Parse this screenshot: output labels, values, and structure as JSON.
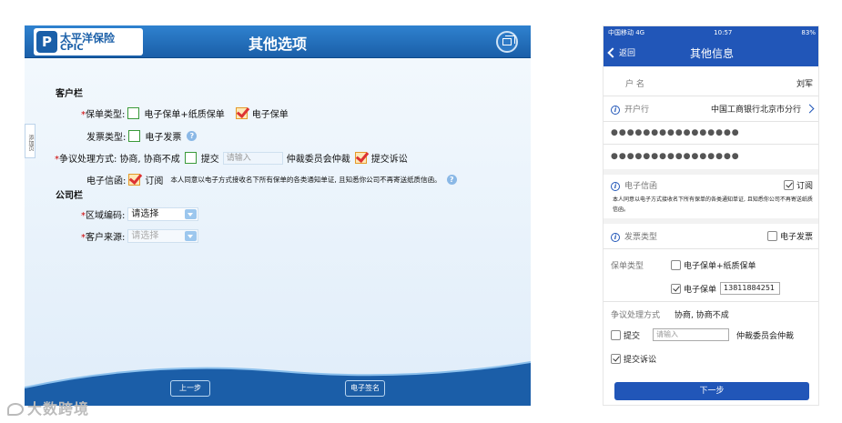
{
  "tablet": {
    "brand": {
      "name_cn": "太平洋保险",
      "name_en": "CPIC",
      "mark": "P"
    },
    "title": "其他选项",
    "side_tab": "添加页",
    "customer_section": "客户栏",
    "policy_type_label": "保单类型:",
    "policy_type_opt1": "电子保单+纸质保单",
    "policy_type_opt2": "电子保单",
    "invoice_type_label": "发票类型:",
    "invoice_type_opt": "电子发票",
    "dispute_label": "争议处理方式:",
    "dispute_text": "协商, 协商不成",
    "dispute_submit": "提交",
    "dispute_placeholder": "请输入",
    "dispute_arbitration": "仲裁委员会仲裁",
    "dispute_lawsuit": "提交诉讼",
    "ecorr_label": "电子信函:",
    "ecorr_subscribe": "订阅",
    "ecorr_note": "本人同意以电子方式接收名下所有保单的各类通知单证, 且知悉你公司不再寄送纸质信函。",
    "company_section": "公司栏",
    "region_label": "区域编码:",
    "region_value": "请选择",
    "source_label": "客户来源:",
    "source_value": "请选择",
    "prev_button": "上一步",
    "sign_button": "电子签名",
    "help": "?"
  },
  "watermark": "大数跨境",
  "phone": {
    "status": {
      "carrier": "中国移动  4G",
      "time": "10:57",
      "battery": "83%"
    },
    "back": "返回",
    "title": "其他信息",
    "account_name_label": "户    名",
    "account_name_value": "刘军",
    "bank_label": "开户行",
    "bank_value": "中国工商银行北京市分行",
    "masked1": "●●●●●●●●●●●●●●●●",
    "masked2": "●●●●●●●●●●●●●●●●",
    "ecorr_label": "电子信函",
    "ecorr_subscribe": "订阅",
    "ecorr_note": "本人同意以电子方式接收名下所有保单的各类通知单证, 且知悉你公司不再寄送纸质信函。",
    "invoice_label": "发票类型",
    "invoice_opt": "电子发票",
    "policy_label": "保单类型",
    "policy_opt1": "电子保单+纸质保单",
    "policy_opt2": "电子保单",
    "policy_phone": "13811884251",
    "dispute_label": "争议处理方式",
    "dispute_text": "协商, 协商不成",
    "submit_label": "提交",
    "submit_placeholder": "请输入",
    "arbitration": "仲裁委员会仲裁",
    "lawsuit": "提交诉讼",
    "next_button": "下一步"
  }
}
